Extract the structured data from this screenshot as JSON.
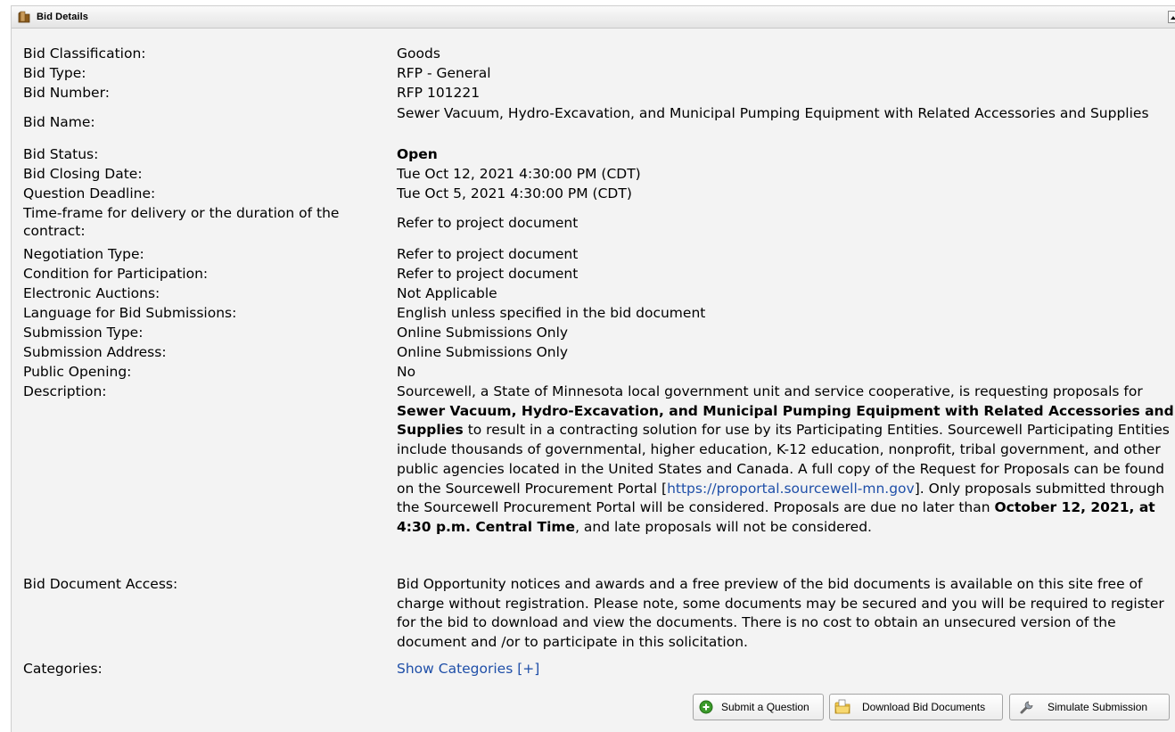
{
  "panel": {
    "title": "Bid Details"
  },
  "fields": {
    "classification": {
      "label": "Bid Classification:",
      "value": "Goods"
    },
    "type": {
      "label": "Bid Type:",
      "value": "RFP - General"
    },
    "number": {
      "label": "Bid Number:",
      "value": "RFP 101221"
    },
    "name": {
      "label": "Bid Name:",
      "value": "Sewer Vacuum, Hydro-Excavation, and Municipal Pumping Equipment with Related Accessories and Supplies"
    },
    "status": {
      "label": "Bid Status:",
      "value": "Open"
    },
    "closing_date": {
      "label": "Bid Closing Date:",
      "value": "Tue Oct 12, 2021 4:30:00 PM (CDT)"
    },
    "question_deadline": {
      "label": "Question Deadline:",
      "value": "Tue Oct 5, 2021 4:30:00 PM (CDT)"
    },
    "timeframe": {
      "label": "Time-frame for delivery or the duration of the contract:",
      "value": "Refer to project document"
    },
    "negotiation_type": {
      "label": "Negotiation Type:",
      "value": "Refer to project document"
    },
    "condition": {
      "label": "Condition for Participation:",
      "value": "Refer to project document"
    },
    "auctions": {
      "label": "Electronic Auctions:",
      "value": "Not Applicable"
    },
    "language": {
      "label": "Language for Bid Submissions:",
      "value": "English unless specified in the bid document"
    },
    "submission_type": {
      "label": "Submission Type:",
      "value": "Online Submissions Only"
    },
    "submission_address": {
      "label": "Submission Address:",
      "value": "Online Submissions Only"
    },
    "public_opening": {
      "label": "Public Opening:",
      "value": "No"
    },
    "description": {
      "label": "Description:",
      "part1": "Sourcewell, a State of Minnesota local government unit and service cooperative, is requesting proposals for ",
      "bold1": "Sewer Vacuum, Hydro-Excavation, and Municipal Pumping Equipment with Related Accessories and Supplies",
      "part2": " to result in a contracting solution for use by its Participating Entities. Sourcewell Participating Entities include thousands of governmental, higher education, K-12 education, nonprofit, tribal government, and other public agencies located in the United States and Canada. A full copy of the Request for Proposals can be found on the Sourcewell Procurement Portal [",
      "link": "https://proportal.sourcewell-mn.gov",
      "part3": "]. Only proposals submitted through the Sourcewell Procurement Portal will be considered. Proposals are due no later than ",
      "bold2": "October 12, 2021, at 4:30 p.m. Central Time",
      "part4": ", and late proposals will not be considered."
    },
    "document_access": {
      "label": "Bid Document Access:",
      "value": "Bid Opportunity notices and awards and a free preview of the bid documents is available on this site free of charge without registration. Please note, some documents may be secured and you will be required to register for the bid to download and view the documents. There is no cost to obtain an unsecured version of the document and /or to participate in this solicitation."
    },
    "categories": {
      "label": "Categories:",
      "link": "Show Categories [+]"
    }
  },
  "buttons": {
    "submit_question": "Submit a Question",
    "download_docs": "Download Bid Documents",
    "simulate": "Simulate Submission"
  },
  "colors": {
    "link": "#1f4fa8",
    "panel_bg": "#f3f3f3",
    "submit_icon": "#3a9a2a"
  }
}
